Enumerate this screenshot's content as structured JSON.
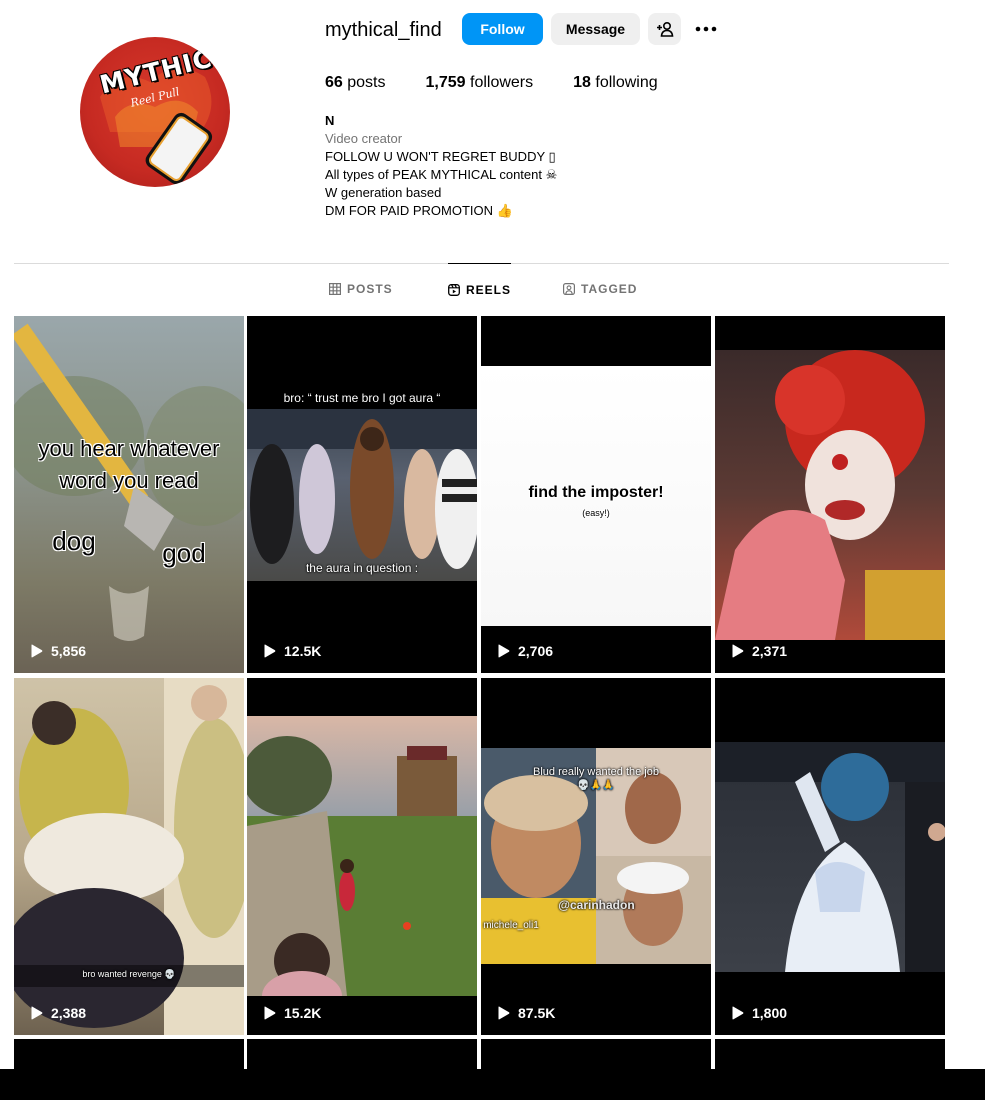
{
  "profile": {
    "username": "mythical_find",
    "avatar_text": "MYTHIC",
    "avatar_subtext": "Reel Pull",
    "follow_label": "Follow",
    "message_label": "Message",
    "stats": {
      "posts_count": "66",
      "posts_label": "posts",
      "followers_count": "1,759",
      "followers_label": "followers",
      "following_count": "18",
      "following_label": "following"
    },
    "bio": {
      "name": "N",
      "category": "Video creator",
      "line1": "FOLLOW U WON'T REGRET BUDDY ▯",
      "line2": "All types of PEAK MYTHICAL content ☠",
      "line3": "W generation based",
      "line4": "DM FOR PAID PROMOTION 👍"
    }
  },
  "tabs": [
    {
      "label": "POSTS",
      "icon": "grid-icon",
      "active": false
    },
    {
      "label": "REELS",
      "icon": "reels-icon",
      "active": true
    },
    {
      "label": "TAGGED",
      "icon": "tagged-icon",
      "active": false
    }
  ],
  "reels": [
    {
      "views": "5,856",
      "captions": [
        "you hear whatever",
        "word you read",
        "dog",
        "god"
      ]
    },
    {
      "views": "12.5K",
      "captions": [
        "bro: “ trust me bro I got aura “",
        "the aura in question :"
      ]
    },
    {
      "views": "2,706",
      "captions": [
        "find the imposter!",
        "(easy!)"
      ]
    },
    {
      "views": "2,371",
      "captions": []
    },
    {
      "views": "2,388",
      "captions": [
        "bro wanted revenge 💀"
      ]
    },
    {
      "views": "15.2K",
      "captions": []
    },
    {
      "views": "87.5K",
      "captions": [
        "Blud really wanted the job",
        "💀🙏🙏",
        "@carinhadon",
        "michele_oli1"
      ]
    },
    {
      "views": "1,800",
      "captions": []
    }
  ],
  "colors": {
    "accent": "#0095f6",
    "secondary_button": "#efefef",
    "muted_text": "#737373",
    "divider": "#dbdbdb"
  }
}
